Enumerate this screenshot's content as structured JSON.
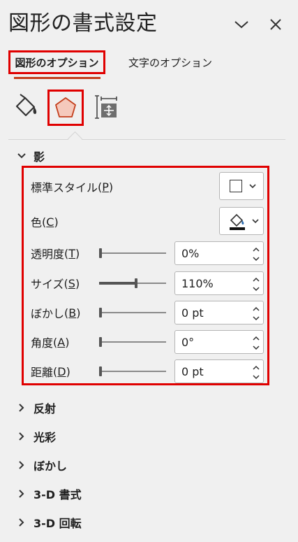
{
  "header": {
    "title": "図形の書式設定",
    "collapse_icon": "chevron-down-icon",
    "close_icon": "close-icon"
  },
  "tabs": {
    "shape_options": "図形のオプション",
    "text_options": "文字のオプション"
  },
  "icon_tabs": [
    "fill-line-icon",
    "effects-pentagon-icon",
    "size-properties-icon"
  ],
  "sections": {
    "shadow": {
      "title": "影",
      "preset": {
        "label": "標準スタイル",
        "key": "P"
      },
      "color": {
        "label": "色",
        "key": "C"
      },
      "transparency": {
        "label": "透明度",
        "key": "T",
        "value": "0%",
        "level": 0
      },
      "size": {
        "label": "サイズ",
        "key": "S",
        "value": "110%",
        "level": 0.55
      },
      "blur": {
        "label": "ぼかし",
        "key": "B",
        "value": "0 pt",
        "level": 0
      },
      "angle": {
        "label": "角度",
        "key": "A",
        "value": "0°",
        "level": 0
      },
      "distance": {
        "label": "距離",
        "key": "D",
        "value": "0 pt",
        "level": 0
      }
    },
    "collapsed": [
      "反射",
      "光彩",
      "ぼかし",
      "3-D 書式",
      "3-D 回転"
    ]
  },
  "colors": {
    "highlight_border": "#e00000",
    "accent_underline": "#c43e1c",
    "icon_fill": "#f5c9bc",
    "icon_stroke": "#c43e1c"
  }
}
